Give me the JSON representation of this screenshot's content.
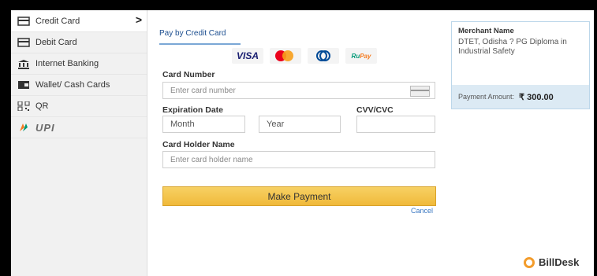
{
  "sidebar": {
    "items": [
      {
        "label": "Credit Card",
        "icon": "credit-card-icon"
      },
      {
        "label": "Debit Card",
        "icon": "debit-card-icon"
      },
      {
        "label": "Internet Banking",
        "icon": "bank-icon"
      },
      {
        "label": "Wallet/ Cash Cards",
        "icon": "wallet-icon"
      },
      {
        "label": "QR",
        "icon": "qr-icon"
      },
      {
        "label": "UPI",
        "icon": "upi-icon"
      }
    ],
    "active_arrow": ">"
  },
  "main": {
    "tab_label": "Pay by Credit Card",
    "brands": [
      "VISA",
      "Mastercard",
      "Diners Club",
      "RuPay"
    ],
    "card_number_label": "Card Number",
    "card_number_placeholder": "Enter card number",
    "expiration_label": "Expiration Date",
    "month_placeholder": "Month",
    "year_placeholder": "Year",
    "cvv_label": "CVV/CVC",
    "holder_label": "Card Holder Name",
    "holder_placeholder": "Enter card holder name",
    "pay_button": "Make Payment",
    "cancel": "Cancel"
  },
  "merchant": {
    "title": "Merchant Name",
    "description": "DTET, Odisha ? PG Diploma in Industrial Safety",
    "payment_label": "Payment Amount:",
    "amount": "₹ 300.00"
  },
  "footer": {
    "brand": "BillDesk"
  },
  "colors": {
    "accent": "#f0b93a",
    "link": "#3b78c2",
    "merchant_bg": "#dceaf4"
  }
}
